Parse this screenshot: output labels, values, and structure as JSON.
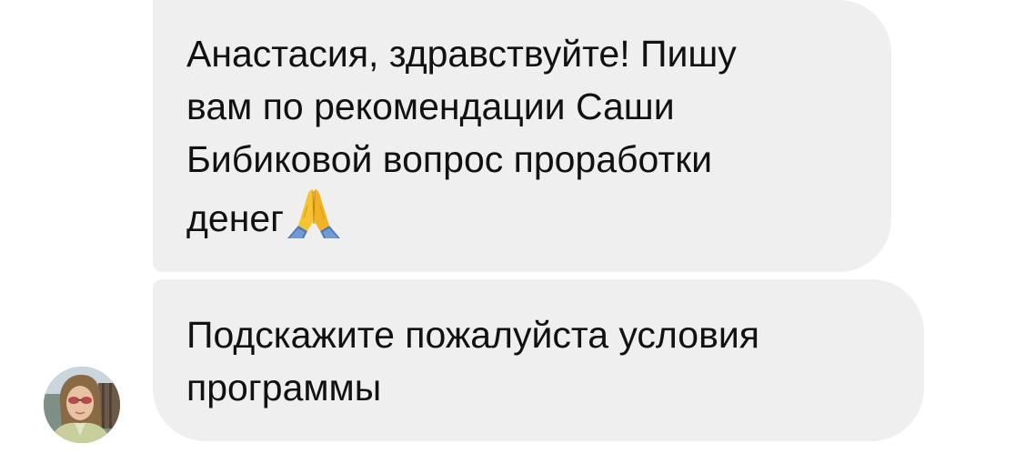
{
  "messages": [
    {
      "lines": [
        "Анастасия, здравствуйте! Пишу",
        "вам по рекомендации Саши",
        "Бибиковой вопрос проработки",
        "денег"
      ],
      "emoji": "folded-hands-icon"
    },
    {
      "lines": [
        "Подскажите пожалуйста условия",
        "программы"
      ]
    }
  ],
  "sender": {
    "avatar": "avatar-photo"
  },
  "colors": {
    "bubble_bg": "#efeff0",
    "text": "#111111",
    "emoji_yellow": "#f7c331",
    "emoji_blue": "#4a78b8"
  }
}
